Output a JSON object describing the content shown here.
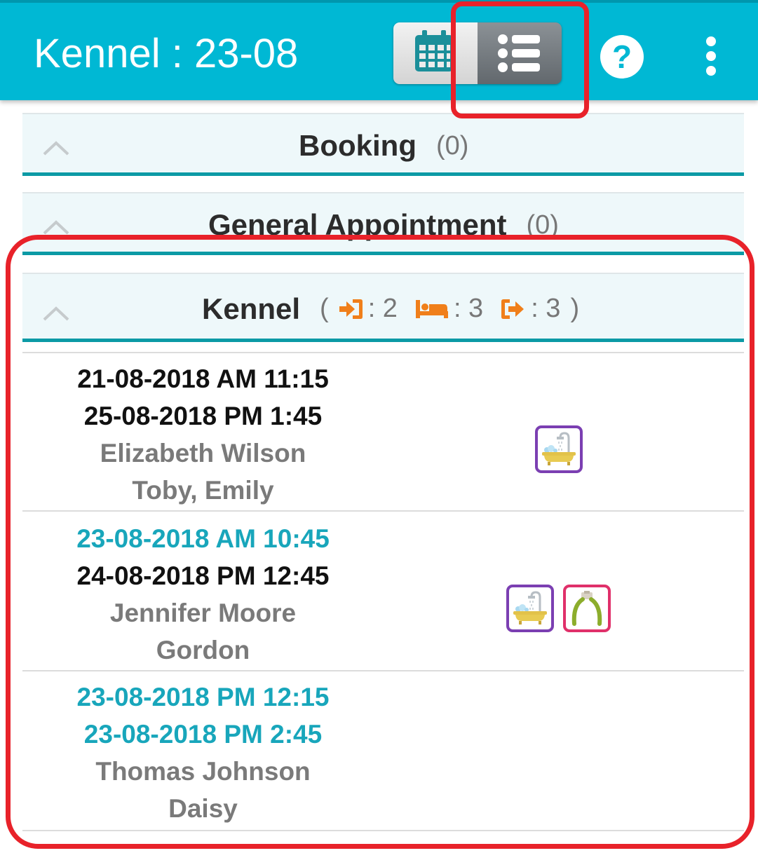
{
  "header": {
    "title": "Kennel : 23-08",
    "view_toggle": {
      "calendar_icon": "calendar-icon",
      "list_icon": "list-icon",
      "selected": "list"
    },
    "help_icon": "help-icon",
    "more_icon": "more-vertical-icon"
  },
  "sections": {
    "booking": {
      "title": "Booking",
      "count": "(0)"
    },
    "general": {
      "title": "General Appointment",
      "count": "(0)"
    },
    "kennel": {
      "title": "Kennel",
      "open_paren": "(",
      "close_paren": ")",
      "checkin_count": ": 2",
      "staying_count": ": 3",
      "checkout_count": ": 3"
    }
  },
  "entries": [
    {
      "start": "21-08-2018 AM 11:15",
      "end": "25-08-2018 PM 1:45",
      "owner": "Elizabeth Wilson",
      "pets": "Toby, Emily",
      "services": [
        "bath-icon"
      ]
    },
    {
      "start": "23-08-2018 AM 10:45",
      "end": "24-08-2018 PM 12:45",
      "owner": "Jennifer Moore",
      "pets": "Gordon",
      "services": [
        "bath-icon",
        "nail-clipper-icon"
      ]
    },
    {
      "start": "23-08-2018 PM 12:15",
      "end": "23-08-2018 PM 2:45",
      "owner": "Thomas Johnson",
      "pets": "Daisy",
      "services": []
    }
  ],
  "colors": {
    "appbar": "#00b8d4",
    "section_underline": "#0b9aa5",
    "highlight": "#e8222a",
    "today_date": "#18a6bb",
    "status_icon": "#f07f1a"
  }
}
